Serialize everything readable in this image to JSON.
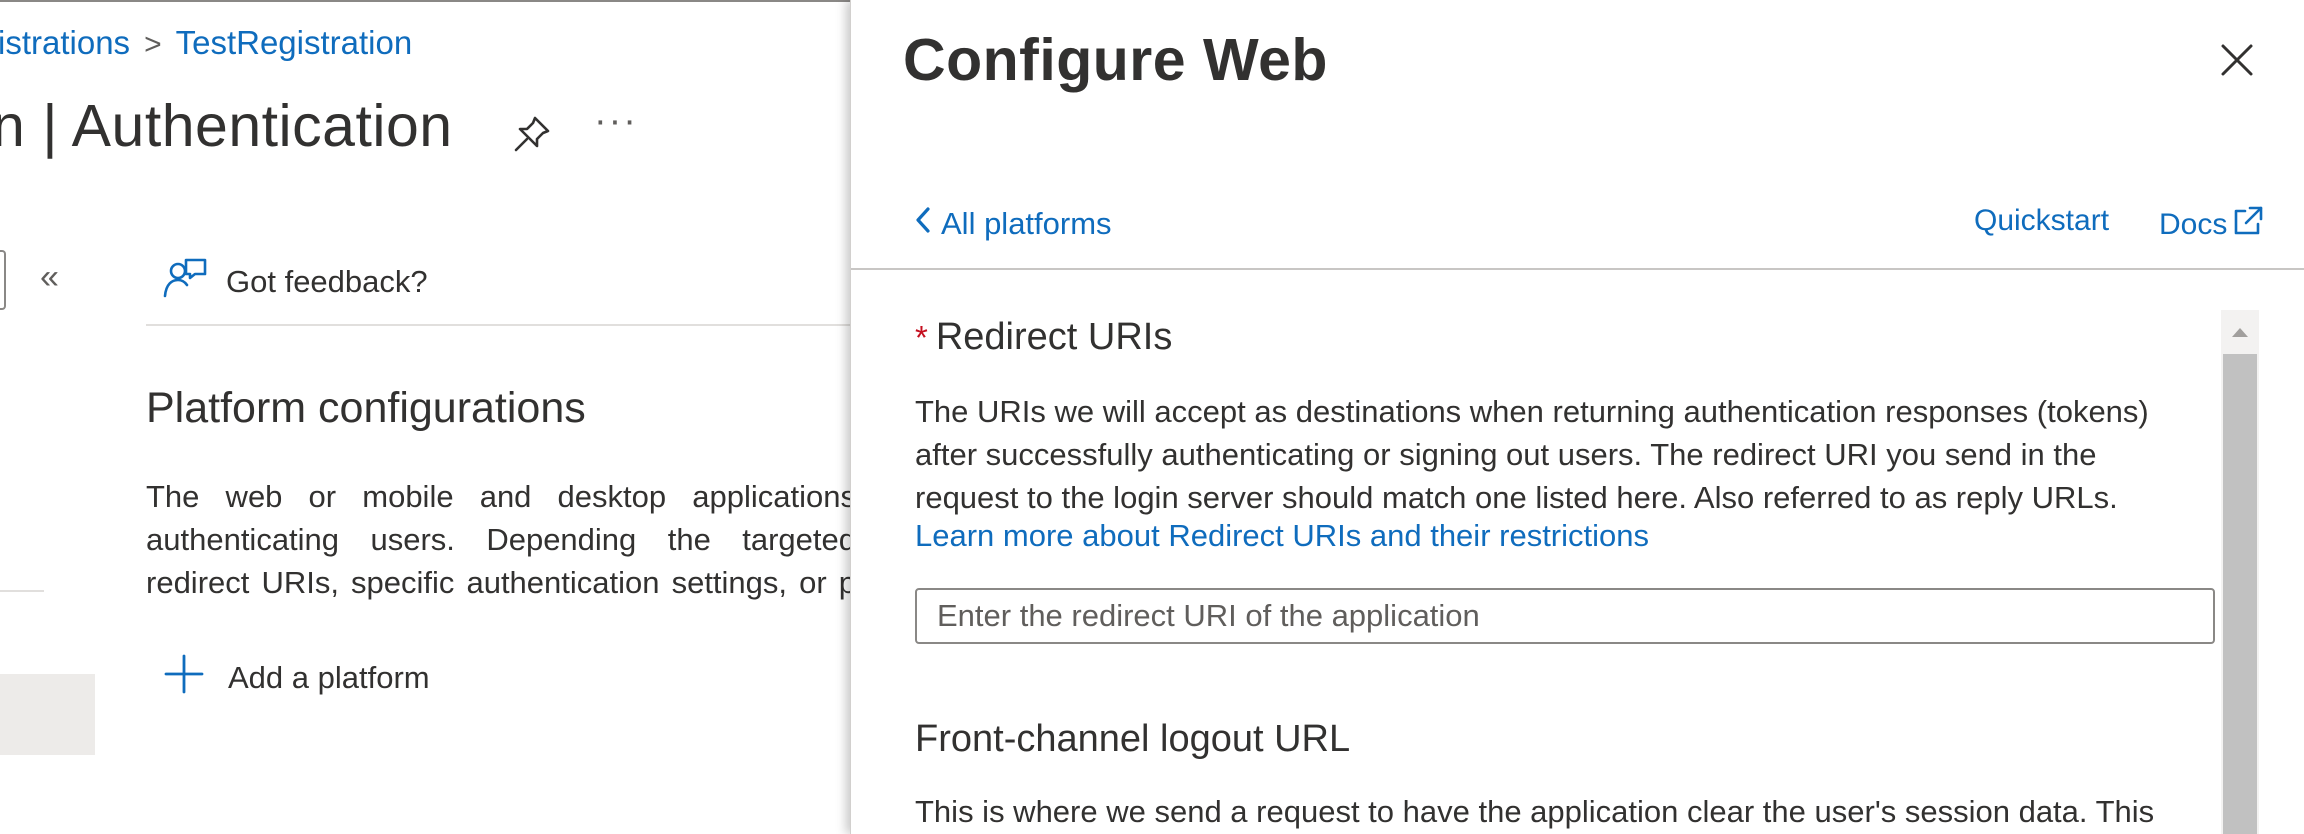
{
  "breadcrumb": {
    "parent": "istrations",
    "separator": ">",
    "current": "TestRegistration"
  },
  "page": {
    "title": "n | Authentication",
    "more_label": "···"
  },
  "toolbar": {
    "collapse_label": "«",
    "feedback_label": "Got feedback?"
  },
  "platform_configurations": {
    "title": "Platform configurations",
    "description_lines": [
      "The web or mobile and desktop applications",
      "authenticating users. Depending the targeted",
      "redirect URIs, specific authentication settings, or p"
    ],
    "add_label": "Add a platform"
  },
  "panel": {
    "title": "Configure Web",
    "back_label": "All platforms",
    "quickstart_label": "Quickstart",
    "docs_label": "Docs",
    "redirect": {
      "required_mark": "*",
      "heading": "Redirect URIs",
      "description_lines": [
        "The URIs we will accept as destinations when returning authentication responses (tokens)",
        "after successfully authenticating or signing out users. The redirect URI you send in the",
        "request to the login server should match one listed here. Also referred to as reply URLs."
      ],
      "learn_more": "Learn more about Redirect URIs and their restrictions",
      "input_value": "",
      "input_placeholder": "Enter the redirect URI of the application"
    },
    "front_channel": {
      "heading": "Front-channel logout URL",
      "description": "This is where we send a request to have the application clear the user's session data. This"
    }
  },
  "colors": {
    "link": "#0f6cbd",
    "text": "#323130",
    "required": "#c50f1f",
    "scrollbar_thumb": "#c1c1c1"
  }
}
